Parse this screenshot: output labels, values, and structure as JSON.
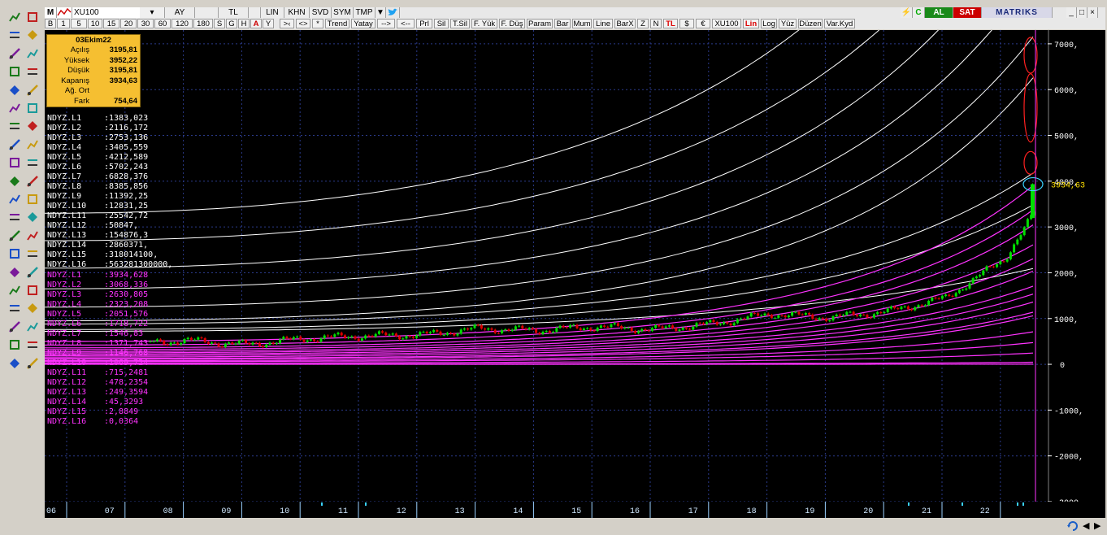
{
  "toolbar": {
    "app_icon": "M",
    "symbol": "XU100",
    "period": "AY",
    "currency": "TL",
    "scale": "LIN",
    "menu": [
      "KHN",
      "SVD",
      "SYM",
      "TMP"
    ],
    "al_label": "AL",
    "sat_label": "SAT",
    "brand": "MATRIKS",
    "periods": [
      "B",
      "1",
      "5",
      "10",
      "15",
      "20",
      "30",
      "60",
      "120",
      "180",
      "S",
      "G",
      "H",
      "A",
      "Y"
    ],
    "tools": [
      ">‹",
      "<>",
      "*",
      "Trend",
      "Yatay",
      "-->",
      "<--",
      "Prl",
      "Sil",
      "T.Sil",
      "F. Yük",
      "F. Düş",
      "Param",
      "Bar",
      "Mum",
      "Line",
      "BarX",
      "Z",
      "N",
      "TL",
      "$",
      "€",
      "XU100",
      "Lin",
      "Log",
      "Yüz",
      "Düzen",
      "Var.Kyd"
    ]
  },
  "info": {
    "date": "03Ekim22",
    "rows": [
      {
        "label": "Açılış",
        "value": "3195,81"
      },
      {
        "label": "Yüksek",
        "value": "3952,22"
      },
      {
        "label": "Düşük",
        "value": "3195,81"
      },
      {
        "label": "Kapanış",
        "value": "3934,63"
      },
      {
        "label": "Ağ. Ort",
        "value": ""
      },
      {
        "label": "Fark",
        "value": "754,64"
      }
    ]
  },
  "levels_white": [
    {
      "name": "NDYZ.L1",
      "value": ":1383,023"
    },
    {
      "name": "NDYZ.L2",
      "value": ":2116,172"
    },
    {
      "name": "NDYZ.L3",
      "value": ":2753,136"
    },
    {
      "name": "NDYZ.L4",
      "value": ":3405,559"
    },
    {
      "name": "NDYZ.L5",
      "value": ":4212,589"
    },
    {
      "name": "NDYZ.L6",
      "value": ":5702,243"
    },
    {
      "name": "NDYZ.L7",
      "value": ":6828,376"
    },
    {
      "name": "NDYZ.L8",
      "value": ":8385,856"
    },
    {
      "name": "NDYZ.L9",
      "value": ":11392,25"
    },
    {
      "name": "NDYZ.L10",
      "value": ":12831,25"
    },
    {
      "name": "NDYZ.L11",
      "value": ":25542,72"
    },
    {
      "name": "NDYZ.L12",
      "value": ":50847,"
    },
    {
      "name": "NDYZ.L13",
      "value": ":154876,3"
    },
    {
      "name": "NDYZ.L14",
      "value": ":2860371,"
    },
    {
      "name": "NDYZ.L15",
      "value": ":318014100,"
    },
    {
      "name": "NDYZ.L16",
      "value": ":563281300000,"
    }
  ],
  "levels_magenta": [
    {
      "name": "NDYZ.L1",
      "value": ":3934,628"
    },
    {
      "name": "NDYZ.L2",
      "value": ":3068,336"
    },
    {
      "name": "NDYZ.L3",
      "value": ":2630,805"
    },
    {
      "name": "NDYZ.L4",
      "value": ":2323,208"
    },
    {
      "name": "NDYZ.L5",
      "value": ":2051,576"
    },
    {
      "name": "NDYZ.L6",
      "value": ":1718,722"
    },
    {
      "name": "NDYZ.L7",
      "value": ":1546,83"
    },
    {
      "name": "NDYZ.L8",
      "value": ":1371,743"
    },
    {
      "name": "NDYZ.L9",
      "value": ":1146,768"
    },
    {
      "name": "NDYZ.L10",
      "value": ":1069,724"
    },
    {
      "name": "NDYZ.L11",
      "value": ":715,2481"
    },
    {
      "name": "NDYZ.L12",
      "value": ":478,2354"
    },
    {
      "name": "NDYZ.L13",
      "value": ":249,3594"
    },
    {
      "name": "NDYZ.L14",
      "value": ":45,3293"
    },
    {
      "name": "NDYZ.L15",
      "value": ":2,8849"
    },
    {
      "name": "NDYZ.L16",
      "value": ":0,0364"
    }
  ],
  "chart_data": {
    "type": "line",
    "ylim": [
      -3000,
      7300
    ],
    "yticks": [
      "7000,",
      "6000,",
      "5000,",
      "4000,",
      "3000,",
      "2000,",
      "1000,",
      "0",
      "-1000,",
      "-2000,",
      "-3000,"
    ],
    "ytick_values": [
      7000,
      6000,
      5000,
      4000,
      3000,
      2000,
      1000,
      0,
      -1000,
      -2000,
      -3000
    ],
    "last_price_label": "3934,63",
    "last_price": 3934.63,
    "xticks": [
      "06",
      "07",
      "08",
      "09",
      "10",
      "11",
      "12",
      "13",
      "14",
      "15",
      "16",
      "17",
      "18",
      "19",
      "20",
      "21",
      "22"
    ],
    "grid": true,
    "colors": {
      "up": "#00e000",
      "down": "#e00000",
      "white_curves": "#ffffff",
      "magenta_curves": "#ff33ff",
      "grid": "#2a3a8a"
    },
    "price_series": [
      {
        "x": "2006",
        "y": 500
      },
      {
        "x": "2007",
        "y": 450
      },
      {
        "x": "2008",
        "y": 520
      },
      {
        "x": "2009",
        "y": 430
      },
      {
        "x": "2010",
        "y": 560
      },
      {
        "x": "2011",
        "y": 620
      },
      {
        "x": "2012",
        "y": 640
      },
      {
        "x": "2013",
        "y": 780
      },
      {
        "x": "2014",
        "y": 740
      },
      {
        "x": "2015",
        "y": 820
      },
      {
        "x": "2016",
        "y": 760
      },
      {
        "x": "2017",
        "y": 880
      },
      {
        "x": "2018",
        "y": 1100
      },
      {
        "x": "2019",
        "y": 1020
      },
      {
        "x": "2020",
        "y": 1150
      },
      {
        "x": "2021",
        "y": 1450
      },
      {
        "x": "2022",
        "y": 2300
      },
      {
        "x": "2022-10",
        "y": 3934.63
      }
    ]
  },
  "bottom": {
    "nav_icon": "refresh-icon"
  }
}
